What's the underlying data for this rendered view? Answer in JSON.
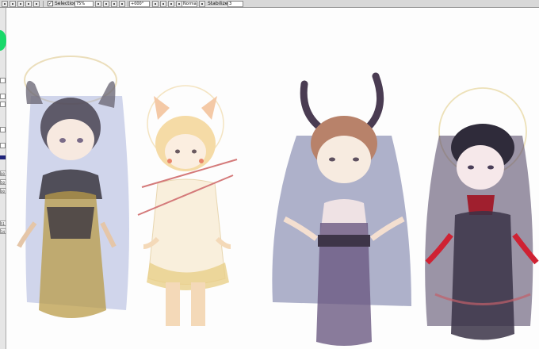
{
  "toolbar": {
    "selection_label": "Selection",
    "selection_checked": true,
    "check_mark": "✓",
    "zoom": "75%",
    "rotation": "+000°",
    "blend_mode": "Normal",
    "stabilizer_label": "Stabilizer",
    "stabilizer_value": "3"
  },
  "tool_panel": {
    "values": [
      "00",
      "50",
      "00",
      "51",
      "34"
    ],
    "primary_color": "#19d96a",
    "secondary_color": "#20247a"
  },
  "canvas": {
    "description_icons": [
      "nun-figure",
      "cat-figure",
      "horned-figure",
      "veiled-figure"
    ]
  }
}
